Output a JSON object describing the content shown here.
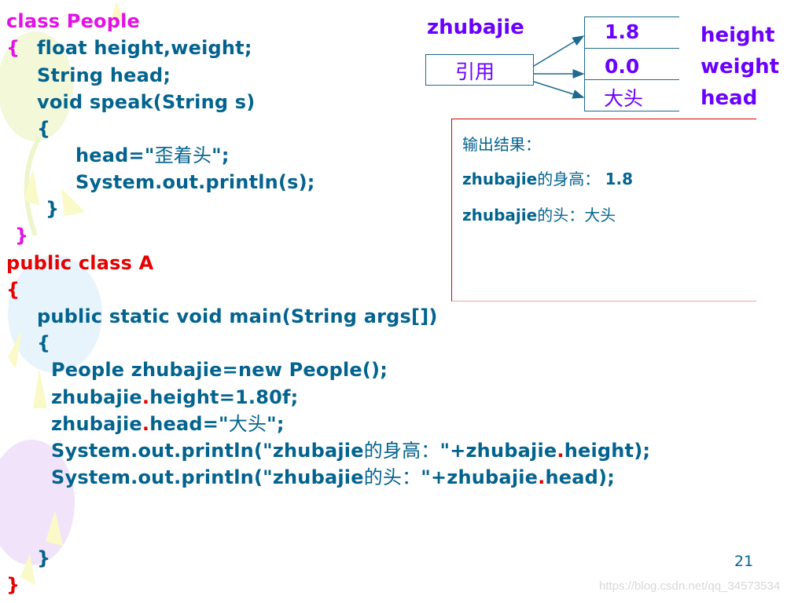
{
  "slide": {
    "page_number": "21",
    "watermark": "https://blog.csdn.net/qq_34573534"
  },
  "code": {
    "class_people": {
      "header": "class People",
      "open_brace": "{",
      "field_line": "float height,weight;",
      "string_line": "String head;",
      "method_sig": "void speak(String s)",
      "method_open": "{",
      "assign_prefix": "head=\"",
      "assign_cjk": "歪着头",
      "assign_suffix": "\";",
      "println": "System.out.println(s);",
      "method_close": "}",
      "close_brace": "}"
    },
    "class_a": {
      "header": "public class A",
      "open_brace": "{",
      "main_sig": "public static void main(String args[])",
      "main_open": "{",
      "new_line": "People zhubajie=new People();",
      "height_obj": "zhubajie",
      "dot": ".",
      "height_rest": "height=1.80f;",
      "head_obj": "zhubajie",
      "head_rest_prefix": "head=\"",
      "head_cjk": "大头",
      "head_rest_suffix": "\";",
      "print1_prefix": "System.out.println(\"zhubajie",
      "print1_cjk": "的身高：",
      "print1_mid": "\"+zhubajie",
      "print1_end": "height);",
      "print2_prefix": "System.out.println(\"zhubajie",
      "print2_cjk": "的头：",
      "print2_mid": "\"+zhubajie",
      "print2_end": "head);",
      "main_close": "}",
      "close_brace": "}"
    }
  },
  "diagram": {
    "object_name": "zhubajie",
    "reference_label": "引用",
    "fields": [
      {
        "value": "1.8",
        "name": "height"
      },
      {
        "value": "0.0",
        "name": "weight"
      },
      {
        "value": "大头",
        "name": "head"
      }
    ]
  },
  "output": {
    "title": "输出结果：",
    "line1_prefix": "zhubajie",
    "line1_cjk": "的身高：",
    "line1_value": "1.8",
    "line2_prefix": "zhubajie",
    "line2_cjk": "的头：大头"
  },
  "colors": {
    "code_blue": "#03638F",
    "keyword_magenta": "#E510E5",
    "keyword_red": "#E60000",
    "diagram_purple": "#6A00FF",
    "output_border": "#E00000"
  }
}
